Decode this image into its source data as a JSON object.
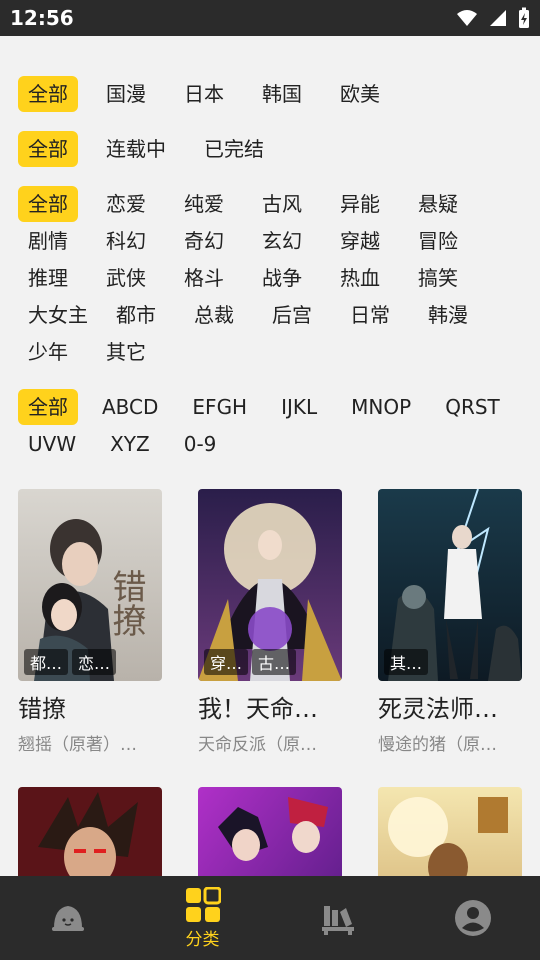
{
  "status_bar": {
    "time": "12:56"
  },
  "filters": {
    "region": [
      "全部",
      "国漫",
      "日本",
      "韩国",
      "欧美"
    ],
    "status": [
      "全部",
      "连载中",
      "已完结"
    ],
    "genre": [
      "全部",
      "恋爱",
      "纯爱",
      "古风",
      "异能",
      "悬疑",
      "剧情",
      "科幻",
      "奇幻",
      "玄幻",
      "穿越",
      "冒险",
      "推理",
      "武侠",
      "格斗",
      "战争",
      "热血",
      "搞笑",
      "大女主",
      "都市",
      "总裁",
      "后宫",
      "日常",
      "韩漫",
      "少年",
      "其它"
    ],
    "letter": [
      "全部",
      "ABCD",
      "EFGH",
      "IJKL",
      "MNOP",
      "QRST",
      "UVW",
      "XYZ",
      "0-9"
    ]
  },
  "comics": [
    {
      "title": "错撩",
      "author": "翘摇（原著）…",
      "tags": [
        "都…",
        "恋…"
      ],
      "cover_text": "错撩"
    },
    {
      "title": "我！天命…",
      "author": "天命反派（原…",
      "tags": [
        "穿…",
        "古…"
      ]
    },
    {
      "title": "死灵法师…",
      "author": "慢途的猪（原…",
      "tags": [
        "其…"
      ]
    },
    {
      "title": "",
      "author": "",
      "tags": []
    },
    {
      "title": "",
      "author": "",
      "tags": []
    },
    {
      "title": "",
      "author": "",
      "tags": []
    }
  ],
  "bottom_nav": {
    "items": [
      {
        "icon": "home-bun-icon",
        "label": ""
      },
      {
        "icon": "category-grid-icon",
        "label": "分类",
        "active": true
      },
      {
        "icon": "bookshelf-icon",
        "label": ""
      },
      {
        "icon": "profile-icon",
        "label": ""
      }
    ]
  },
  "colors": {
    "accent": "#ffd21c",
    "bar": "#2b2b2b",
    "background": "#f2f2f2"
  }
}
